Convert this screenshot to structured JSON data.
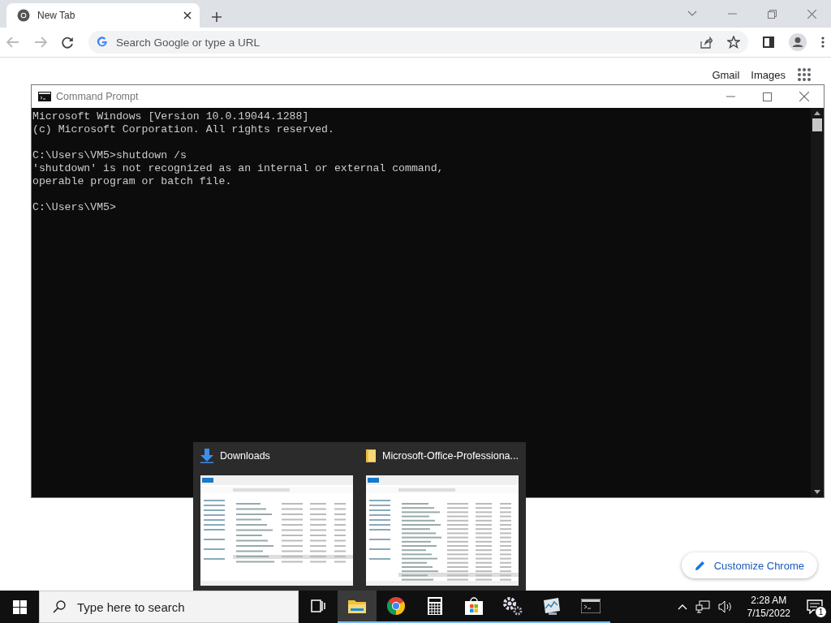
{
  "browser": {
    "tabs": [
      {
        "title": "New Tab",
        "selected": true
      }
    ],
    "address": {
      "placeholder": "Search Google or type a URL"
    },
    "links": [
      "Gmail",
      "Images"
    ],
    "customize_button": "Customize Chrome"
  },
  "console": {
    "title": "Command Prompt",
    "blocks": [
      [
        "Microsoft Windows [Version 10.0.19044.1288]",
        "(c) Microsoft Corporation. All rights reserved."
      ],
      [
        "C:\\Users\\VM5>shutdown /s",
        "'shutdown' is not recognized as an internal or external command,",
        "operable program or batch file."
      ],
      [
        "C:\\Users\\VM5>"
      ]
    ]
  },
  "thumbnails": [
    {
      "title": "Downloads",
      "kind": "downloads"
    },
    {
      "title": "Microsoft-Office-Professiona...",
      "kind": "folder"
    }
  ],
  "taskbar": {
    "search": {
      "placeholder": "Type here to search"
    },
    "apps": [
      {
        "kind": "taskview",
        "running": false,
        "selected": false
      },
      {
        "kind": "explorer",
        "running": true,
        "selected": true
      },
      {
        "kind": "chrome",
        "running": true,
        "selected": false
      },
      {
        "kind": "calculator",
        "running": true,
        "selected": false
      },
      {
        "kind": "store",
        "running": true,
        "selected": false
      },
      {
        "kind": "settings",
        "running": true,
        "selected": false
      },
      {
        "kind": "monitor",
        "running": true,
        "selected": false
      },
      {
        "kind": "console",
        "running": true,
        "selected": false
      }
    ],
    "time": "2:28 AM",
    "date": "7/15/2022",
    "notifications": "1"
  }
}
